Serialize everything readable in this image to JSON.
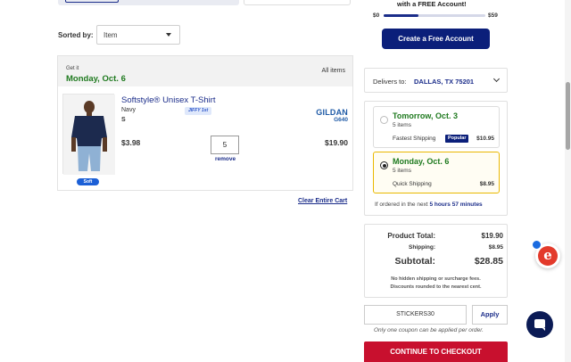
{
  "sort": {
    "label": "Sorted by:",
    "value": "Item"
  },
  "cart": {
    "get_it_label": "Get it",
    "delivery_date": "Monday, Oct. 6",
    "all_items_label": "All items",
    "item": {
      "name": "Softstyle® Unisex T-Shirt",
      "color": "Navy",
      "size": "S",
      "badge": "JIFFY 1st",
      "soft_badge": "Soft",
      "brand": "GILDAN",
      "sku": "G640",
      "unit_price": "$3.98",
      "quantity": "5",
      "remove_label": "remove",
      "line_total": "$19.90",
      "shirt_color": "#1c2a4e"
    },
    "clear_label": "Clear Entire Cart"
  },
  "free_shipping": {
    "headline": "with a FREE Account!",
    "min_label": "$0",
    "max_label": "$59",
    "progress_fraction": 0.34,
    "create_button": "Create a Free Account"
  },
  "delivery": {
    "label": "Delivers to:",
    "location": "DALLAS, TX 75201"
  },
  "shipping_options": [
    {
      "date": "Tomorrow, Oct. 3",
      "items": "5 items",
      "method": "Fastest Shipping",
      "badge": "Popular",
      "price": "$10.95",
      "selected": false
    },
    {
      "date": "Monday, Oct. 6",
      "items": "5 items",
      "method": "Quick Shipping",
      "badge": "",
      "price": "$8.95",
      "selected": true
    }
  ],
  "order_deadline": {
    "prefix": "If ordered in the next",
    "time": "5 hours 57 minutes"
  },
  "totals": {
    "product_total_label": "Product Total:",
    "product_total": "$19.90",
    "shipping_label": "Shipping:",
    "shipping": "$8.95",
    "subtotal_label": "Subtotal:",
    "subtotal": "$28.85",
    "note_line1": "No hidden shipping or surcharge fees.",
    "note_line2": "Discounts rounded to the nearest cent."
  },
  "coupon": {
    "code": "STICKERS30",
    "apply_label": "Apply",
    "note": "Only one coupon can be applied per order."
  },
  "checkout_label": "CONTINUE TO CHECKOUT",
  "colors": {
    "brand_blue": "#1b2d8a",
    "green": "#1f7a1f",
    "checkout_red": "#c8102e",
    "selected_border": "#e9b800"
  }
}
